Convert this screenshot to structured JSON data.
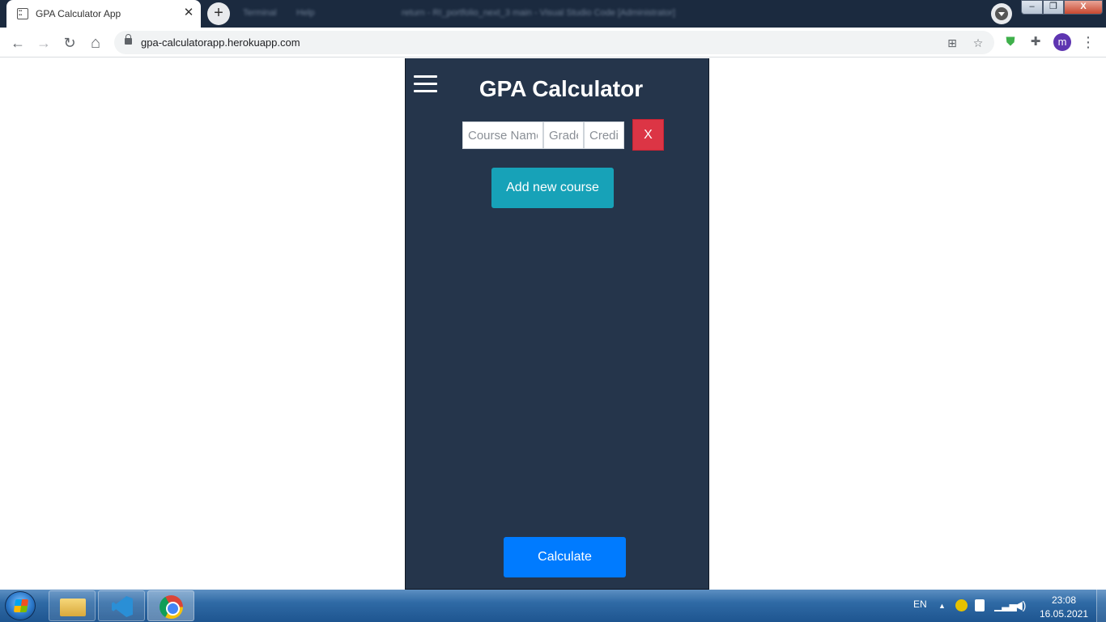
{
  "browser": {
    "tab_title": "GPA Calculator App",
    "tab_close": "✕",
    "new_tab": "+",
    "background_window_text": [
      "Terminal",
      "Help",
      "return - RI_portfolio_next_3 main - Visual Studio Code [Administrator]"
    ],
    "url": "gpa-calculatorapp.herokuapp.com",
    "profile_initial": "m",
    "nav": {
      "back": "←",
      "forward": "→",
      "reload": "↻",
      "home": "⌂"
    },
    "window_controls": {
      "minimize": "–",
      "maximize": "❐",
      "close": "X"
    }
  },
  "app": {
    "title": "GPA Calculator",
    "course": {
      "name_placeholder": "Course Name",
      "grade_placeholder": "Grade",
      "credit_placeholder": "Credit",
      "remove_label": "X"
    },
    "add_button_label": "Add new course",
    "calculate_button_label": "Calculate"
  },
  "taskbar": {
    "language": "EN",
    "time": "23:08",
    "date": "16.05.2021",
    "tray_arrow": "▲"
  },
  "colors": {
    "panel_bg": "#25354b",
    "remove_red": "#dc3545",
    "add_teal": "#17a2b8",
    "calculate_blue": "#007bff"
  }
}
